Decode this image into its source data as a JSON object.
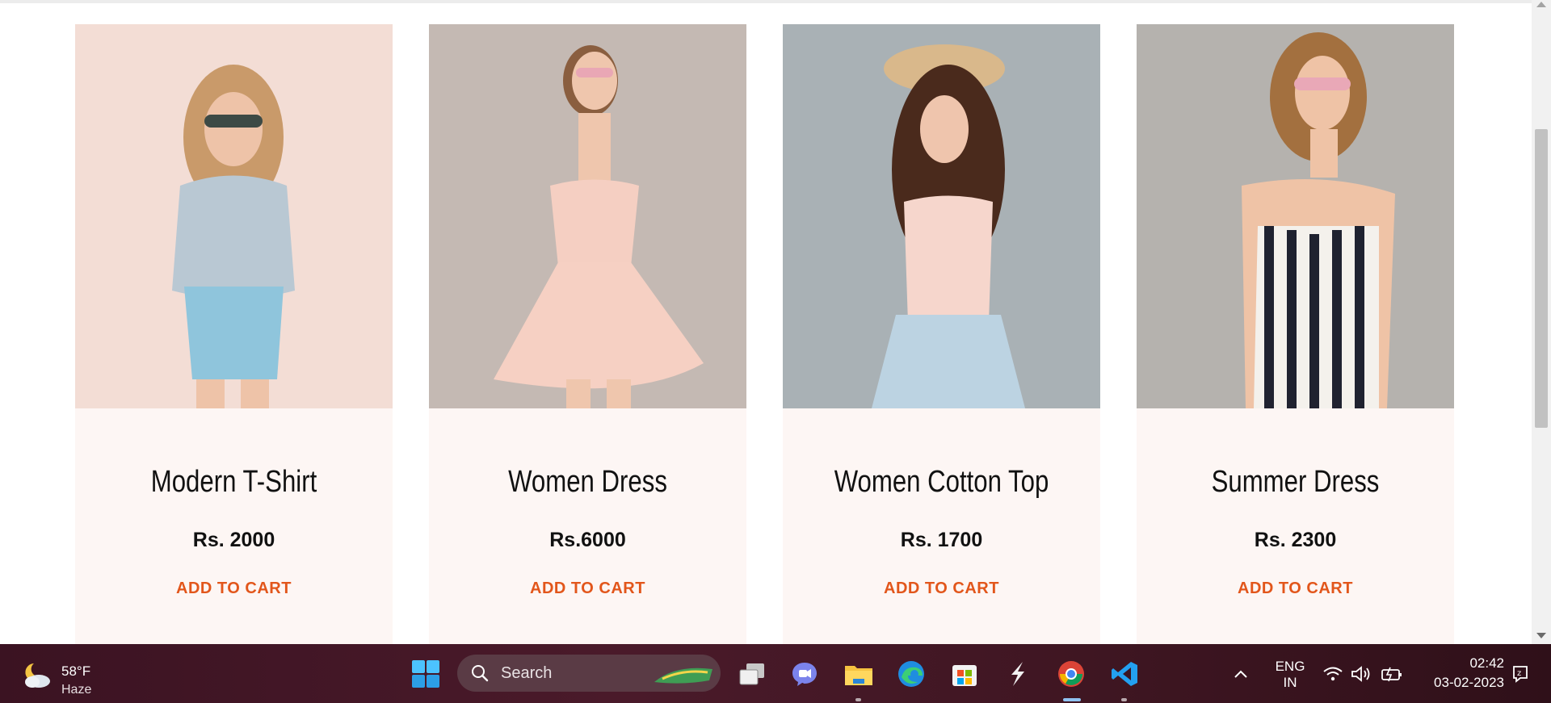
{
  "products": [
    {
      "name": "Modern T-Shirt",
      "price": "Rs. 2000",
      "cta": "ADD TO CART"
    },
    {
      "name": "Women Dress",
      "price": "Rs.6000",
      "cta": "ADD TO CART"
    },
    {
      "name": "Women Cotton Top",
      "price": "Rs. 1700",
      "cta": "ADD TO CART"
    },
    {
      "name": "Summer Dress",
      "price": "Rs. 2300",
      "cta": "ADD TO CART"
    }
  ],
  "colors": {
    "accent": "#e2561b",
    "card_bg": "#fdf6f4",
    "taskbar": "#3b1322"
  },
  "taskbar": {
    "weather": {
      "temp": "58°F",
      "condition": "Haze",
      "icon": "partly-cloudy-night-icon"
    },
    "search_label": "Search",
    "apps": [
      "windows-start-icon",
      "task-view-icon",
      "teams-chat-icon",
      "file-explorer-icon",
      "edge-icon",
      "microsoft-store-icon",
      "app-s-icon",
      "chrome-icon",
      "vscode-icon"
    ],
    "language": {
      "line1": "ENG",
      "line2": "IN"
    },
    "time": "02:42",
    "date": "03-02-2023"
  }
}
